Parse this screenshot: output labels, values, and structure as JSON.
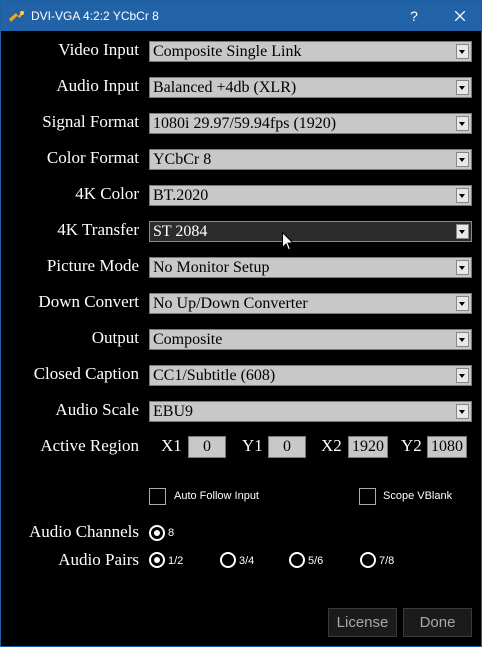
{
  "window": {
    "title": "DVI-VGA 4:2:2 YCbCr 8",
    "help_label": "?"
  },
  "fields": [
    {
      "label": "Video Input",
      "value": "Composite Single Link"
    },
    {
      "label": "Audio Input",
      "value": "Balanced +4db (XLR)"
    },
    {
      "label": "Signal Format",
      "value": "1080i 29.97/59.94fps (1920)"
    },
    {
      "label": "Color Format",
      "value": "YCbCr 8"
    },
    {
      "label": "4K Color",
      "value": "BT.2020"
    },
    {
      "label": "4K Transfer",
      "value": "ST 2084"
    },
    {
      "label": "Picture Mode",
      "value": "No Monitor Setup"
    },
    {
      "label": "Down Convert",
      "value": "No Up/Down Converter"
    },
    {
      "label": "Output",
      "value": "Composite"
    },
    {
      "label": "Closed Caption",
      "value": "CC1/Subtitle (608)"
    },
    {
      "label": "Audio Scale",
      "value": "EBU9"
    }
  ],
  "active_region": {
    "label": "Active Region",
    "x1_label": "X1",
    "x1": "0",
    "y1_label": "Y1",
    "y1": "0",
    "x2_label": "X2",
    "x2": "1920",
    "y2_label": "Y2",
    "y2": "1080"
  },
  "options": {
    "auto_follow_input": {
      "label": "Auto Follow Input",
      "checked": false
    },
    "scope_vblank": {
      "label": "Scope VBlank",
      "checked": false
    }
  },
  "audio_channels": {
    "label": "Audio Channels",
    "options": [
      "8"
    ],
    "selected": "8"
  },
  "audio_pairs": {
    "label": "Audio Pairs",
    "options": [
      "1/2",
      "3/4",
      "5/6",
      "7/8"
    ],
    "selected": "1/2"
  },
  "buttons": {
    "license": "License",
    "done": "Done"
  },
  "colors": {
    "titlebar": "#2263a8",
    "dropdown_bg": "#c8c8c8",
    "dropdown_focused_bg": "#2c2c2c"
  }
}
